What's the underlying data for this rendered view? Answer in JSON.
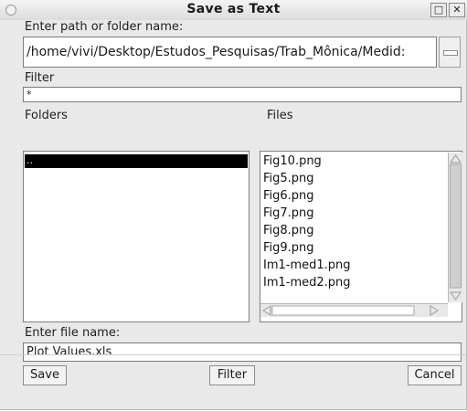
{
  "window": {
    "title": "Save as Text",
    "maximize_glyph": "□",
    "close_glyph": "✕"
  },
  "path": {
    "label": "Enter path or folder name:",
    "value": "/home/vivi/Desktop/Estudos_Pesquisas/Trab_Mônica/Medid:"
  },
  "filter": {
    "label": "Filter",
    "value": "*"
  },
  "folders": {
    "label": "Folders",
    "items": [
      ".."
    ]
  },
  "files": {
    "label": "Files",
    "items": [
      "Fig10.png",
      "Fig5.png",
      "Fig6.png",
      "Fig7.png",
      "Fig8.png",
      "Fig9.png",
      "Im1-med1.png",
      "Im1-med2.png"
    ]
  },
  "filename": {
    "label": "Enter file name:",
    "value": "Plot Values.xls"
  },
  "buttons": {
    "save": "Save",
    "filter": "Filter",
    "cancel": "Cancel"
  },
  "icons": [
    "window-menu-icon",
    "maximize-icon",
    "close-icon",
    "browse-icon",
    "scroll-up-icon",
    "scroll-down-icon",
    "scroll-left-icon",
    "scroll-right-icon"
  ]
}
